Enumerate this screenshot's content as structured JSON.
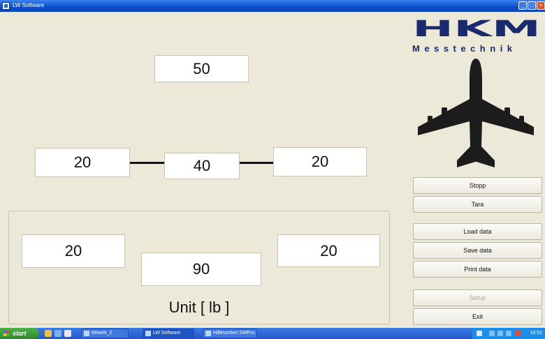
{
  "window": {
    "title": "LW Software",
    "min_glyph": "_",
    "max_glyph": "□",
    "close_glyph": "×"
  },
  "values": {
    "top": "50",
    "mid_left": "20",
    "mid_center": "40",
    "mid_right": "20",
    "low_left": "20",
    "low_center": "90",
    "low_right": "20"
  },
  "unit_label": "Unit [ lb ]",
  "logo": {
    "letters": "HKM",
    "subtitle": "Messtechnik",
    "color": "#1a2a6e",
    "plane_icon": "airplane-icon"
  },
  "buttons": {
    "stopp": "Stopp",
    "tara": "Tara",
    "load": "Load data",
    "save": "Save data",
    "print": "Print data",
    "setup": "Setup",
    "exit": "Exit"
  },
  "taskbar": {
    "start": "start",
    "tasks": [
      "Mitwirk_2",
      "LW Software",
      "Hilfesortiert SWPro..."
    ],
    "clock": "10:51"
  }
}
